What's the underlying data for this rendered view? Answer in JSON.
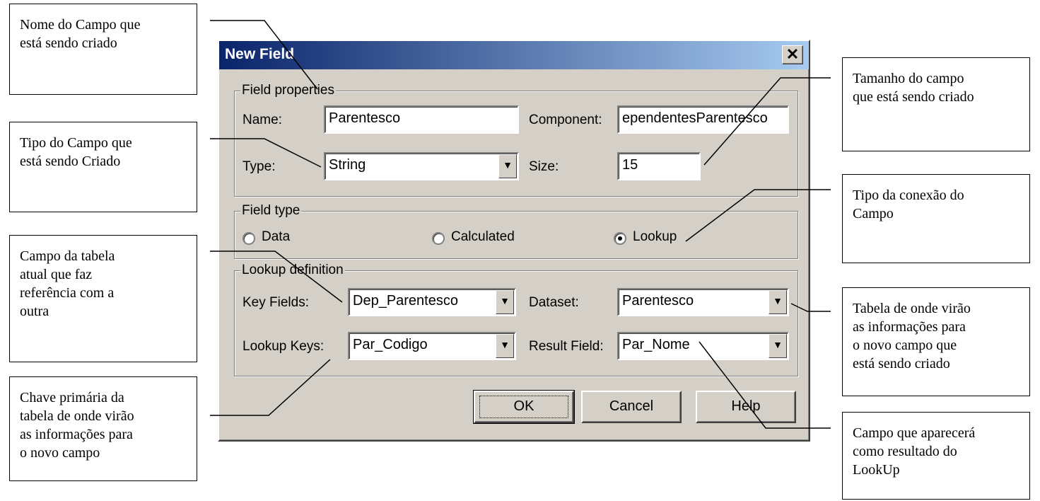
{
  "dialog": {
    "title": "New Field",
    "close_glyph": "✕",
    "field_properties": {
      "legend": "Field properties",
      "name_label": "Name:",
      "name_value": "Parentesco",
      "component_label": "Component:",
      "component_value": "ependentesParentesco",
      "type_label": "Type:",
      "type_value": "String",
      "size_label": "Size:",
      "size_value": "15"
    },
    "field_type": {
      "legend": "Field type",
      "options": [
        {
          "label": "Data",
          "selected": false
        },
        {
          "label": "Calculated",
          "selected": false
        },
        {
          "label": "Lookup",
          "selected": true
        }
      ]
    },
    "lookup_definition": {
      "legend": "Lookup definition",
      "key_fields_label": "Key Fields:",
      "key_fields_value": "Dep_Parentesco",
      "dataset_label": "Dataset:",
      "dataset_value": "Parentesco",
      "lookup_keys_label": "Lookup Keys:",
      "lookup_keys_value": "Par_Codigo",
      "result_field_label": "Result Field:",
      "result_field_value": "Par_Nome"
    },
    "buttons": {
      "ok": "OK",
      "cancel": "Cancel",
      "help": "Help"
    }
  },
  "callouts": {
    "nome_campo": "Nome do Campo que\nestá sendo criado",
    "tipo_campo": "Tipo do Campo que\nestá sendo Criado",
    "campo_tabela": "Campo da tabela\natual que faz\nreferência com a\noutra",
    "chave_primaria": "Chave primária da\ntabela de onde virão\nas informações para\no novo campo",
    "tamanho": "Tamanho do campo\nque está sendo criado",
    "tipo_conexao": "Tipo da conexão do\nCampo",
    "tabela_origem": "Tabela de onde virão\nas informações para\no novo campo que\nestá sendo criado",
    "campo_resultado": "Campo que aparecerá\ncomo resultado do\nLookUp"
  },
  "colors": {
    "titlebar_start": "#0a246a",
    "titlebar_end": "#a6caf0",
    "dialog_face": "#d4d0c8"
  }
}
